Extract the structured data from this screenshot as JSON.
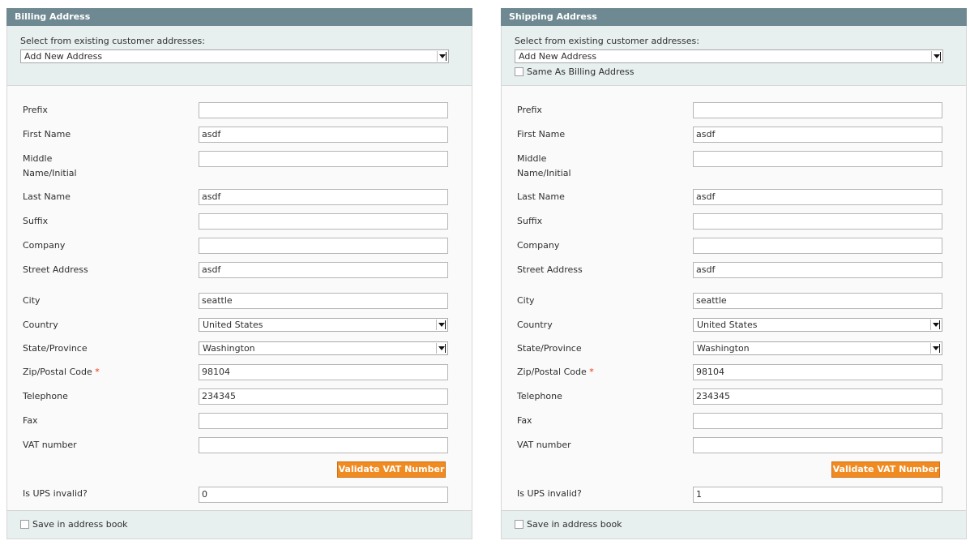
{
  "billing": {
    "title": "Billing Address",
    "select_label": "Select from existing customer addresses:",
    "address_select": "Add New Address",
    "prefix_label": "Prefix",
    "prefix": "",
    "first_name_label": "First Name",
    "first_name": "asdf",
    "middle_name_label_1": "Middle",
    "middle_name_label_2": "Name/Initial",
    "middle_name": "",
    "last_name_label": "Last Name",
    "last_name": "asdf",
    "suffix_label": "Suffix",
    "suffix": "",
    "company_label": "Company",
    "company": "",
    "street_label": "Street Address",
    "street": "asdf",
    "city_label": "City",
    "city": "seattle",
    "country_label": "Country",
    "country": "United States",
    "state_label": "State/Province",
    "state": "Washington",
    "zip_label": "Zip/Postal Code",
    "zip": "98104",
    "phone_label": "Telephone",
    "phone": "234345",
    "fax_label": "Fax",
    "fax": "",
    "vat_label": "VAT number",
    "vat": "",
    "validate_vat_label": "Validate VAT Number",
    "ups_label": "Is UPS invalid?",
    "ups": "0",
    "save_in_book_label": "Save in address book"
  },
  "shipping": {
    "title": "Shipping Address",
    "select_label": "Select from existing customer addresses:",
    "address_select": "Add New Address",
    "same_as_billing_label": "Same As Billing Address",
    "prefix_label": "Prefix",
    "prefix": "",
    "first_name_label": "First Name",
    "first_name": "asdf",
    "middle_name_label_1": "Middle",
    "middle_name_label_2": "Name/Initial",
    "middle_name": "",
    "last_name_label": "Last Name",
    "last_name": "asdf",
    "suffix_label": "Suffix",
    "suffix": "",
    "company_label": "Company",
    "company": "",
    "street_label": "Street Address",
    "street": "asdf",
    "city_label": "City",
    "city": "seattle",
    "country_label": "Country",
    "country": "United States",
    "state_label": "State/Province",
    "state": "Washington",
    "zip_label": "Zip/Postal Code",
    "zip": "98104",
    "phone_label": "Telephone",
    "phone": "234345",
    "fax_label": "Fax",
    "fax": "",
    "vat_label": "VAT number",
    "vat": "",
    "validate_vat_label": "Validate VAT Number",
    "ups_label": "Is UPS invalid?",
    "ups": "1",
    "save_in_book_label": "Save in address book"
  },
  "required_marker": "*",
  "colors": {
    "header": "#6f8992",
    "button": "#f08b22",
    "required": "#eb340a",
    "section_bg": "#e7efef"
  }
}
